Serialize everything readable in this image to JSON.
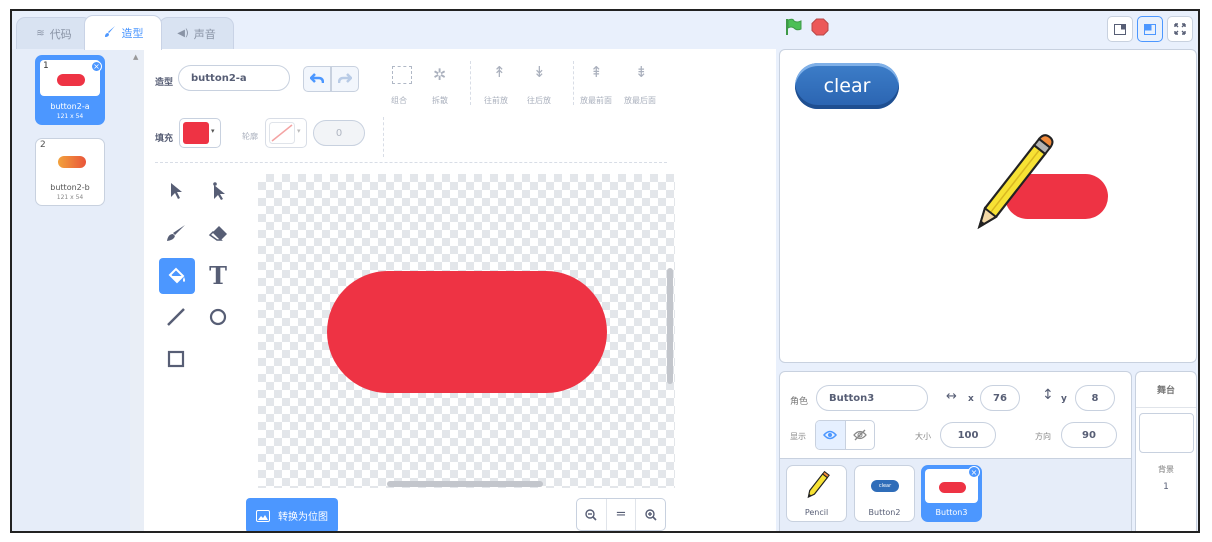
{
  "tabs": {
    "code": "代码",
    "costume": "造型",
    "sound": "声音"
  },
  "costumes": [
    {
      "num": "1",
      "name": "button2-a",
      "size": "121 x 54"
    },
    {
      "num": "2",
      "name": "button2-b",
      "size": "121 x 54"
    }
  ],
  "editor": {
    "costume_label": "造型",
    "costume_name": "button2-a",
    "group": "组合",
    "ungroup": "拆散",
    "forward": "往前放",
    "backward": "往后放",
    "front": "放最前面",
    "back": "放最后面",
    "fill_label": "填充",
    "outline_label": "轮廓",
    "outline_width": "0",
    "convert_button": "转换为位图",
    "zoom_reset": "="
  },
  "stage": {
    "button_text": "clear"
  },
  "sprite_info": {
    "sprite_label": "角色",
    "sprite_name": "Button3",
    "x_label": "x",
    "x": "76",
    "y_label": "y",
    "y": "8",
    "show_label": "显示",
    "size_label": "大小",
    "size": "100",
    "direction_label": "方向",
    "direction": "90"
  },
  "sprites": [
    {
      "name": "Pencil"
    },
    {
      "name": "Button2",
      "thumb_text": "clear"
    },
    {
      "name": "Button3"
    }
  ],
  "stage_panel": {
    "title": "舞台",
    "backdrop_label": "背景",
    "backdrop_count": "1"
  },
  "colors": {
    "accent": "#4c97ff",
    "fill": "#ee3344",
    "flag": "#4cbf56",
    "stop": "#ec5959"
  },
  "icons": [
    "code-icon",
    "brush-icon",
    "speaker-icon",
    "undo-icon",
    "redo-icon",
    "select-icon",
    "reshape-icon",
    "paint-brush-icon",
    "eraser-icon",
    "fill-icon",
    "text-icon",
    "line-icon",
    "circle-icon",
    "rect-icon",
    "green-flag-icon",
    "stop-icon",
    "eye-icon",
    "hidden-eye-icon"
  ]
}
